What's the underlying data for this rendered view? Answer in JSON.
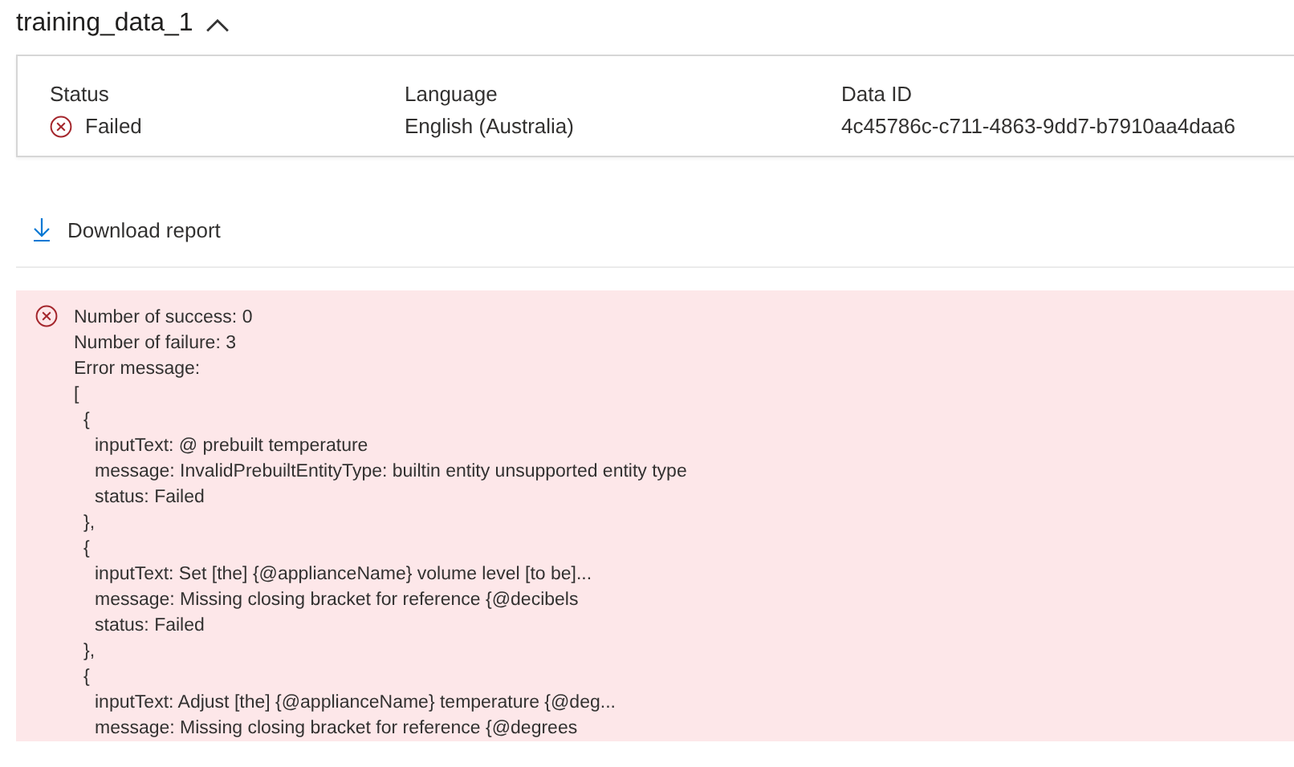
{
  "header": {
    "title": "training_data_1",
    "expanded": true
  },
  "details": [
    {
      "label": "Status",
      "value": "Failed",
      "failed": true
    },
    {
      "label": "Language",
      "value": "English (Australia)"
    },
    {
      "label": "Data ID",
      "value": "4c45786c-c711-4863-9dd7-b7910aa4daa6"
    }
  ],
  "download": {
    "label": "Download report"
  },
  "error": {
    "lines": [
      "Number of success: 0",
      "Number of failure: 3",
      "Error message:",
      "["
    ],
    "entries": [
      {
        "open": "{",
        "fields": [
          "inputText: @ prebuilt temperature",
          "message: InvalidPrebuiltEntityType: builtin entity unsupported entity type",
          "status: Failed"
        ],
        "close": "},"
      },
      {
        "open": "{",
        "fields": [
          "inputText: Set [the] {@applianceName} volume level [to be]...",
          "message: Missing closing bracket for reference {@decibels",
          "status: Failed"
        ],
        "close": "},"
      },
      {
        "open": "{",
        "fields": [
          "inputText: Adjust [the] {@applianceName} temperature {@deg...",
          "message: Missing closing bracket for reference {@degrees"
        ]
      }
    ]
  }
}
